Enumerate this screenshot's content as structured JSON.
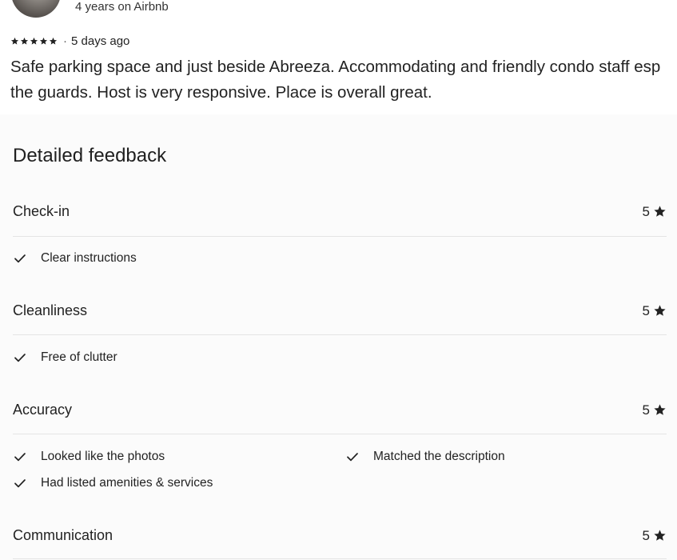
{
  "reviewer": {
    "tenure": "4 years on Airbnb"
  },
  "review": {
    "rating_stars": 5,
    "time_ago": "5 days ago",
    "separator": "·",
    "text": "Safe parking space and just beside Abreeza. Accommodating and friendly condo staff esp the guards. Host is very responsive. Place is overall great."
  },
  "feedback": {
    "title": "Detailed feedback",
    "categories": [
      {
        "name": "Check-in",
        "score": "5",
        "tags": [
          "Clear instructions"
        ]
      },
      {
        "name": "Cleanliness",
        "score": "5",
        "tags": [
          "Free of clutter"
        ]
      },
      {
        "name": "Accuracy",
        "score": "5",
        "tags": [
          "Looked like the photos",
          "Matched the description",
          "Had listed amenities & services"
        ]
      },
      {
        "name": "Communication",
        "score": "5",
        "tags": []
      }
    ]
  },
  "icons": {
    "star": "star-icon",
    "check": "check-icon"
  },
  "colors": {
    "text": "#222222",
    "divider": "#e4e4e4",
    "panel_bg": "#fbfbfb"
  }
}
